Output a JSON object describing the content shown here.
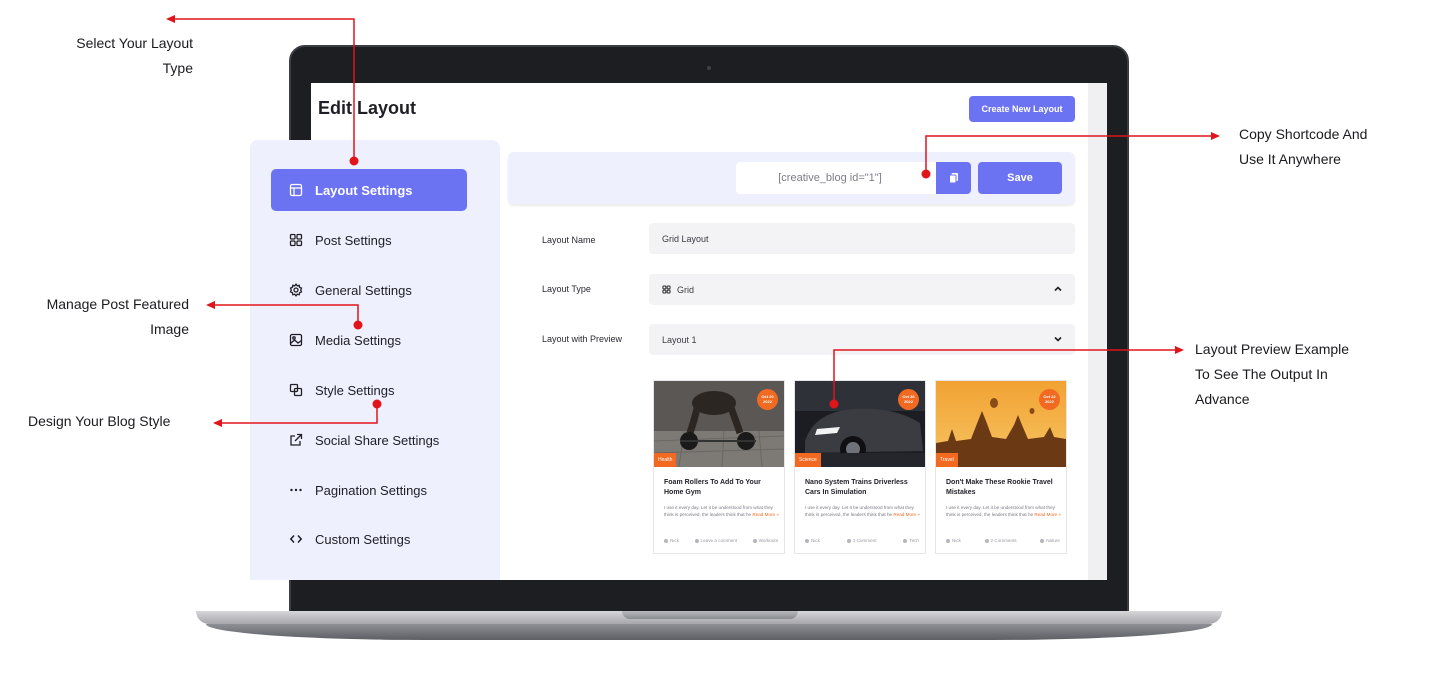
{
  "annotations": {
    "select_layout_line1": "Select Your Layout",
    "select_layout_line2": "Type",
    "copy_shortcode_line1": "Copy Shortcode And",
    "copy_shortcode_line2": "Use It Anywhere",
    "manage_post_line1": "Manage Post Featured",
    "manage_post_line2": "Image",
    "design_blog": "Design Your Blog Style",
    "preview_line1": "Layout Preview Example",
    "preview_line2": "To See The Output In",
    "preview_line3": "Advance"
  },
  "header": {
    "title": "Edit Layout",
    "create_button": "Create New Layout"
  },
  "sidebar": {
    "items": [
      {
        "label": "Layout Settings",
        "icon": "layout-icon",
        "active": true
      },
      {
        "label": "Post Settings",
        "icon": "grid-icon"
      },
      {
        "label": "General Settings",
        "icon": "gear-icon"
      },
      {
        "label": "Media Settings",
        "icon": "image-icon"
      },
      {
        "label": "Style Settings",
        "icon": "layers-icon"
      },
      {
        "label": "Social Share Settings",
        "icon": "external-link-icon"
      },
      {
        "label": "Pagination Settings",
        "icon": "dots-icon"
      },
      {
        "label": "Custom Settings",
        "icon": "code-icon"
      }
    ]
  },
  "toolbar": {
    "shortcode": "[creative_blog id=\"1\"]",
    "save_label": "Save"
  },
  "form": {
    "layout_name_label": "Layout Name",
    "layout_name_value": "Grid Layout",
    "layout_type_label": "Layout Type",
    "layout_type_value": "Grid",
    "layout_preview_label": "Layout with Preview",
    "layout_preview_value": "Layout 1"
  },
  "cards": [
    {
      "date_line1": "Oct 20",
      "date_line2": "2022",
      "category": "Health",
      "title": "Foam Rollers To Add To Your Home Gym",
      "excerpt": "I use it every day. Let it be understood from what they think is perceived, the leaders think that he",
      "read_more": "Read More »",
      "author": "Nick",
      "comments": "Leave a comment",
      "tag": "Workouts"
    },
    {
      "date_line1": "Oct 26",
      "date_line2": "2022",
      "category": "Science",
      "title": "Nano System Trains Driverless Cars In Simulation",
      "excerpt": "I use it every day. Let it be understood from what they think is perceived, the leaders think that he",
      "read_more": "Read More »",
      "author": "Nick",
      "comments": "1 Comment",
      "tag": "Tech"
    },
    {
      "date_line1": "Oct 22",
      "date_line2": "2022",
      "category": "Travel",
      "title": "Don't Make These Rookie Travel Mistakes",
      "excerpt": "I use it every day. Let it be understood from what they think is perceived, the leaders think that he",
      "read_more": "Read More »",
      "author": "Nick",
      "comments": "2 Comments",
      "tag": "Nature"
    }
  ],
  "colors": {
    "accent": "#6c73f2",
    "annotation": "#e0141b",
    "category_badge": "#f26a22"
  }
}
